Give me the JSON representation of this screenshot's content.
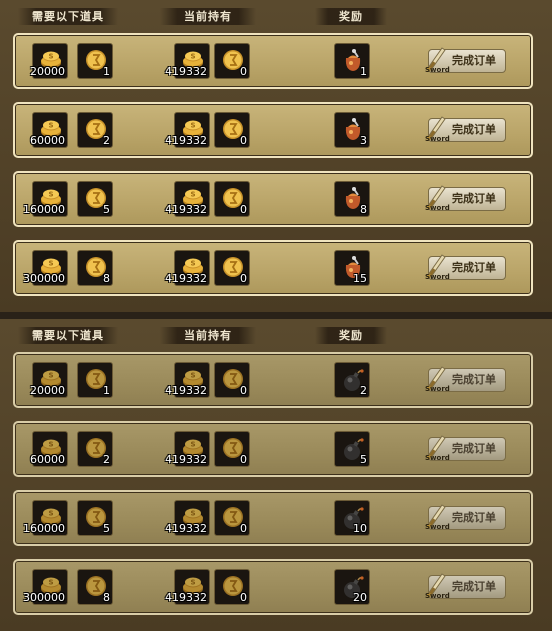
{
  "panels": [
    {
      "headers": {
        "required": "需要以下道具",
        "owned": "当前持有",
        "reward": "奖励"
      },
      "reward_icon": "food-sack-icon",
      "rows": [
        {
          "req_gold": "20000",
          "req_coin": "1",
          "own_gold": "419332",
          "own_coin": "0",
          "reward_count": "1",
          "button": "完成订单",
          "button_tag": "Sword"
        },
        {
          "req_gold": "60000",
          "req_coin": "2",
          "own_gold": "419332",
          "own_coin": "0",
          "reward_count": "3",
          "button": "完成订单",
          "button_tag": "Sword"
        },
        {
          "req_gold": "160000",
          "req_coin": "5",
          "own_gold": "419332",
          "own_coin": "0",
          "reward_count": "8",
          "button": "完成订单",
          "button_tag": "Sword"
        },
        {
          "req_gold": "300000",
          "req_coin": "8",
          "own_gold": "419332",
          "own_coin": "0",
          "reward_count": "15",
          "button": "完成订单",
          "button_tag": "Sword"
        }
      ]
    },
    {
      "headers": {
        "required": "需要以下道具",
        "owned": "当前持有",
        "reward": "奖励"
      },
      "reward_icon": "bomb-icon",
      "rows": [
        {
          "req_gold": "20000",
          "req_coin": "1",
          "own_gold": "419332",
          "own_coin": "0",
          "reward_count": "2",
          "button": "完成订单",
          "button_tag": "Sword"
        },
        {
          "req_gold": "60000",
          "req_coin": "2",
          "own_gold": "419332",
          "own_coin": "0",
          "reward_count": "5",
          "button": "完成订单",
          "button_tag": "Sword"
        },
        {
          "req_gold": "160000",
          "req_coin": "5",
          "own_gold": "419332",
          "own_coin": "0",
          "reward_count": "10",
          "button": "完成订单",
          "button_tag": "Sword"
        },
        {
          "req_gold": "300000",
          "req_coin": "8",
          "own_gold": "419332",
          "own_coin": "0",
          "reward_count": "20",
          "button": "完成订单",
          "button_tag": "Sword"
        }
      ]
    }
  ],
  "colors": {
    "panel_bg": "#5a4a2e",
    "row_bg": "#c8b47a",
    "row_border": "#f0e4bf",
    "slot_bg": "#1a1510",
    "gold": "#e8b23a"
  }
}
